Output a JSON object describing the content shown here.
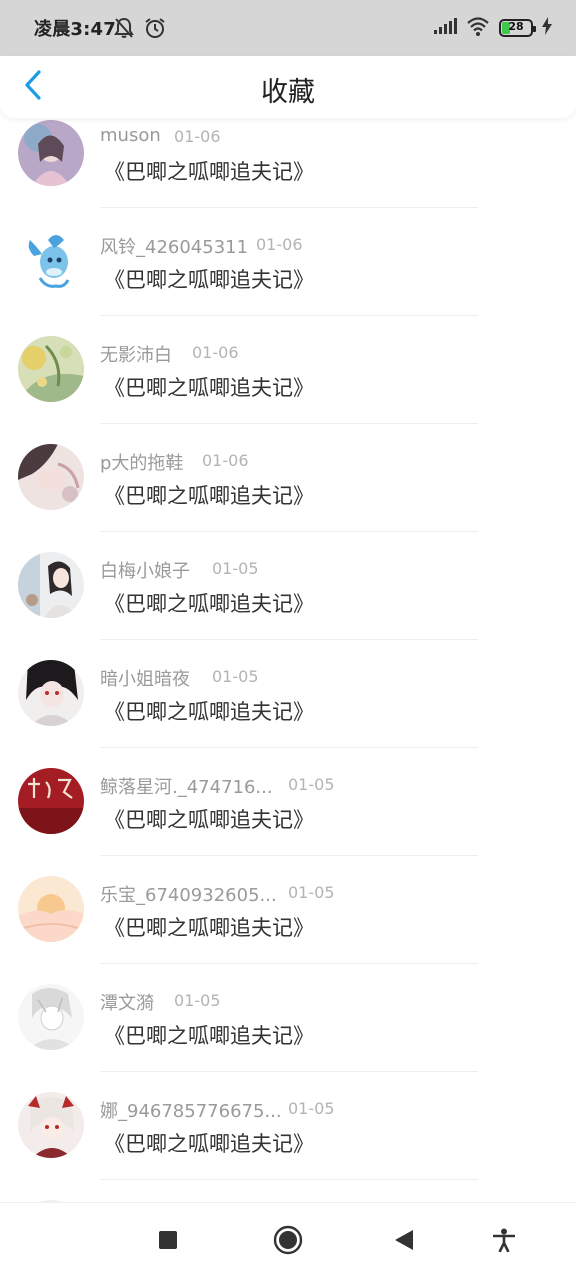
{
  "status_bar": {
    "time": "凌晨3:47",
    "battery": "28"
  },
  "header": {
    "title": "收藏"
  },
  "items": [
    {
      "username": "muson",
      "date": "01-06",
      "title": "《巴唧之呱唧追夫记》"
    },
    {
      "username": "风铃_426045311",
      "date": "01-06",
      "title": "《巴唧之呱唧追夫记》"
    },
    {
      "username": "无影沛白",
      "date": "01-06",
      "title": "《巴唧之呱唧追夫记》"
    },
    {
      "username": "p大的拖鞋",
      "date": "01-06",
      "title": "《巴唧之呱唧追夫记》"
    },
    {
      "username": "白梅小娘子",
      "date": "01-05",
      "title": "《巴唧之呱唧追夫记》"
    },
    {
      "username": "暗小姐暗夜",
      "date": "01-05",
      "title": "《巴唧之呱唧追夫记》"
    },
    {
      "username": "鲸落星河._474716...",
      "date": "01-05",
      "title": "《巴唧之呱唧追夫记》"
    },
    {
      "username": "乐宝_6740932605...",
      "date": "01-05",
      "title": "《巴唧之呱唧追夫记》"
    },
    {
      "username": "潭文漪",
      "date": "01-05",
      "title": "《巴唧之呱唧追夫记》"
    },
    {
      "username": "娜_946785776675...",
      "date": "01-05",
      "title": "《巴唧之呱唧追夫记》"
    }
  ],
  "colors": {
    "accent": "#1e9be6",
    "name_text": "#9a9a9a",
    "date_text": "#b4b4b4"
  },
  "icons": {
    "back": "chevron-left-icon",
    "nav": [
      "square-icon",
      "circle-icon",
      "triangle-back-icon",
      "accessibility-icon"
    ]
  }
}
